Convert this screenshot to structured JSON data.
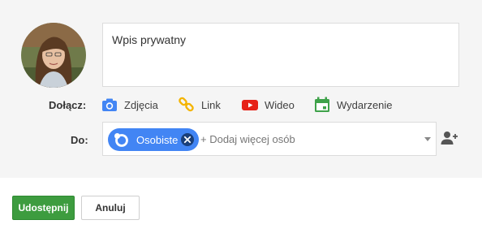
{
  "post": {
    "placeholder": "Wpis prywatny"
  },
  "attach": {
    "label": "Dołącz:",
    "items": [
      {
        "label": "Zdjęcia",
        "icon": "camera-icon",
        "color": "#4285f4"
      },
      {
        "label": "Link",
        "icon": "link-icon",
        "color": "#f4b400"
      },
      {
        "label": "Wideo",
        "icon": "youtube-icon",
        "color": "#e62117"
      },
      {
        "label": "Wydarzenie",
        "icon": "calendar-icon",
        "color": "#3fa24a"
      }
    ]
  },
  "share_to": {
    "label": "Do:",
    "chip": {
      "label": "Osobiste",
      "color": "#4285f4"
    },
    "add_placeholder": "+ Dodaj więcej osób"
  },
  "buttons": {
    "share": "Udostępnij",
    "cancel": "Anuluj"
  },
  "colors": {
    "primary_button": "#3d9c3f",
    "compose_background": "#f5f5f5"
  }
}
